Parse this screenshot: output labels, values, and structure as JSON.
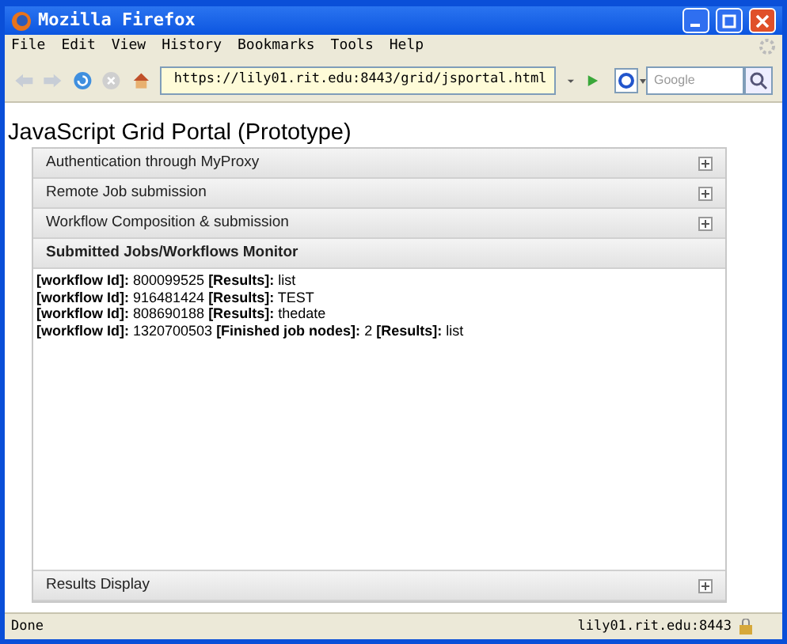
{
  "window": {
    "title": "Mozilla Firefox"
  },
  "menu": [
    "File",
    "Edit",
    "View",
    "History",
    "Bookmarks",
    "Tools",
    "Help"
  ],
  "toolbar": {
    "url": "https://lily01.rit.edu:8443/grid/jsportal.html",
    "search_placeholder": "Google"
  },
  "page": {
    "heading": "JavaScript Grid Portal (Prototype)",
    "panels": [
      {
        "title": "Authentication through MyProxy",
        "expanded": false
      },
      {
        "title": "Remote Job submission",
        "expanded": false
      },
      {
        "title": "Workflow Composition & submission",
        "expanded": false
      },
      {
        "title": "Submitted Jobs/Workflows Monitor",
        "expanded": true,
        "lines": [
          "**[workflow Id]:** 800099525 **[Results]:** list",
          "**[workflow Id]:** 916481424 **[Results]:** TEST",
          "**[workflow Id]:** 808690188 **[Results]:** thedate",
          "**[workflow Id]:** 1320700503 **[Finished job nodes]:** 2 **[Results]:** list"
        ]
      },
      {
        "title": "Results Display",
        "expanded": false
      }
    ]
  },
  "status_bar": {
    "text": "Done",
    "host": "lily01.rit.edu:8443"
  }
}
